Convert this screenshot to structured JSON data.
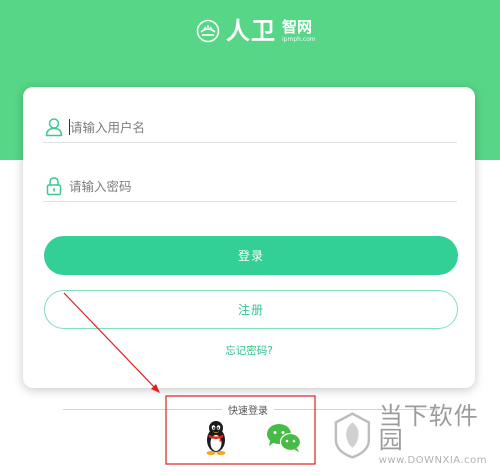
{
  "brand": {
    "name": "人卫",
    "suffix": "智网",
    "url": "ipmph.com"
  },
  "form": {
    "username_placeholder": "请输入用户名",
    "password_placeholder": "请输入密码",
    "login_label": "登录",
    "register_label": "注册",
    "forgot_label": "忘记密码?"
  },
  "quick_login": {
    "label": "快速登录",
    "options": [
      "qq",
      "wechat"
    ]
  },
  "watermark": {
    "text": "当下软件园",
    "sub": "www.DOWNXIA.com"
  },
  "colors": {
    "header": "#58d687",
    "primary": "#32cf96",
    "annotation": "#e02020"
  }
}
